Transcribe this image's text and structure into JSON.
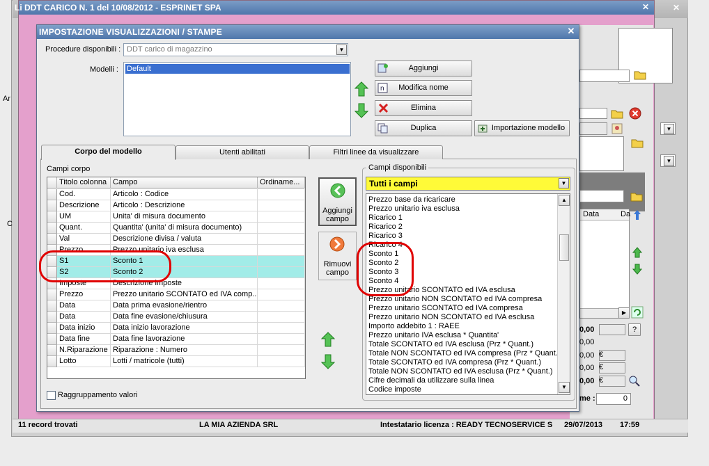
{
  "background_window": {
    "title": "DDT CARICO N. 1 del 10/08/2012 - ESPRINET SPA",
    "title_prefix": "Li",
    "close_icon": "close-icon",
    "status_bar": {
      "records": "11 record trovati",
      "company": "LA MIA AZIENDA SRL",
      "license": "Intestatario licenza : READY TECNOSERVICE S",
      "date": "29/07/2013",
      "time": "17:59"
    },
    "right_fragments": {
      "col_data": "Data",
      "col_da": "Da",
      "val1": "0,00",
      "val2": "0,00",
      "val3": "0,00",
      "val4": "0,00",
      "val5": "0,00",
      "euro1": "€",
      "euro2": "€",
      "euro3": "€",
      "question": "?",
      "me_label": "me :",
      "me_value": "0"
    },
    "left_fragments": {
      "a": "Ar",
      "b": "C"
    }
  },
  "dialog": {
    "title": "IMPOSTAZIONE VISUALIZZAZIONI / STAMPE",
    "procedure_label": "Procedure disponibili :",
    "procedure_value": "DDT carico di magazzino",
    "models_label": "Modelli :",
    "models": [
      "Default"
    ],
    "buttons": {
      "add": "Aggiungi",
      "rename": "Modifica nome",
      "delete": "Elimina",
      "duplicate": "Duplica",
      "import_model": "Importazione modello"
    },
    "tabs": [
      "Corpo del modello",
      "Utenti abilitati",
      "Filtri linee da visualizzare"
    ],
    "campi_corpo_label": "Campi corpo",
    "grid_headers": [
      "Titolo colonna",
      "Campo",
      "Ordiname..."
    ],
    "grid_rows": [
      {
        "title": "Cod.",
        "field": "Articolo : Codice"
      },
      {
        "title": "Descrizione",
        "field": "Articolo : Descrizione"
      },
      {
        "title": "UM",
        "field": "Unita' di misura documento"
      },
      {
        "title": "Quant.",
        "field": "Quantita' (unita' di misura documento)"
      },
      {
        "title": "Val",
        "field": "Descrizione divisa / valuta"
      },
      {
        "title": "Prezzo",
        "field": "Prezzo unitario iva esclusa"
      },
      {
        "title": "S1",
        "field": "Sconto 1"
      },
      {
        "title": "S2",
        "field": "Sconto 2"
      },
      {
        "title": "Imposte",
        "field": "Descrizione imposte"
      },
      {
        "title": "Prezzo",
        "field": "Prezzo unitario SCONTATO ed IVA comp..."
      },
      {
        "title": "Data",
        "field": "Data prima evasione/rientro"
      },
      {
        "title": "Data",
        "field": "Data fine evasione/chiusura"
      },
      {
        "title": "Data inizio",
        "field": "Data inizio lavorazione"
      },
      {
        "title": "Data fine",
        "field": "Data fine lavorazione"
      },
      {
        "title": "N.Riparazione",
        "field": "Riparazione : Numero"
      },
      {
        "title": "Lotto",
        "field": "Lotti / matricole (tutti)"
      }
    ],
    "add_field_button": [
      "Aggiungi",
      "campo"
    ],
    "remove_field_button": [
      "Rimuovi",
      "campo"
    ],
    "group_checkbox_label": "Raggruppamento valori",
    "available_fields_label": "Campi disponibili",
    "available_filter": "Tutti i campi",
    "available_fields": [
      "Prezzo base da ricaricare",
      "Prezzo unitario iva esclusa",
      "Ricarico 1",
      "Ricarico 2",
      "Ricarico 3",
      "Ricarico 4",
      "Sconto 1",
      "Sconto 2",
      "Sconto 3",
      "Sconto 4",
      "Prezzo unitario SCONTATO ed IVA esclusa",
      "Prezzo unitario NON SCONTATO ed IVA compresa",
      "Prezzo unitario SCONTATO ed IVA compresa",
      "Prezzo unitario NON SCONTATO ed IVA esclusa",
      "Importo addebito 1 : RAEE",
      "Prezzo unitario IVA esclusa * Quantita'",
      "Totale SCONTATO ed IVA esclusa (Prz * Quant.)",
      "Totale NON SCONTATO ed IVA compresa (Prz * Quant.)",
      "Totale SCONTATO ed IVA compresa (Prz * Quant.)",
      "Totale NON SCONTATO ed IVA esclusa (Prz * Quant.)",
      "Cifre decimali da utilizzare sulla linea",
      "Codice imposte"
    ],
    "colors": {
      "title_bar": "#4f77ab",
      "highlight_row": "#a2ece8",
      "filter_combo": "#fffa38",
      "annotation": "#e00000"
    }
  }
}
